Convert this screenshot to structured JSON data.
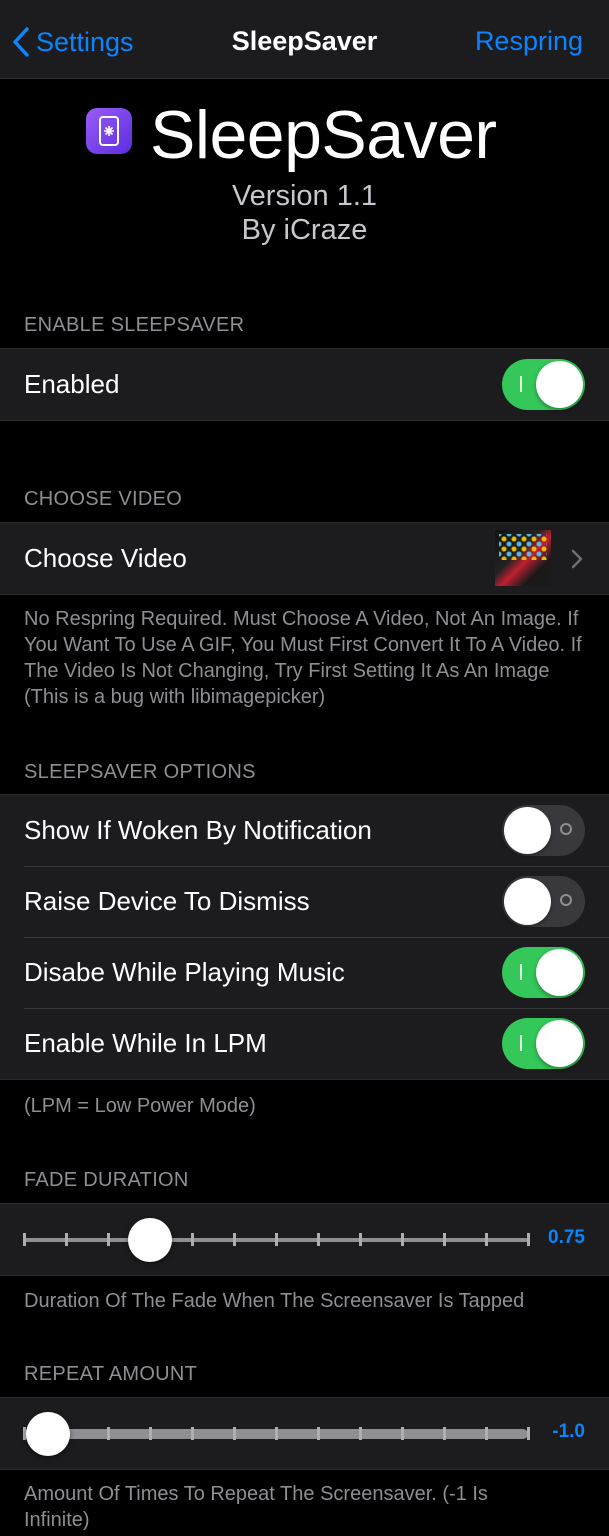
{
  "nav": {
    "back_label": "Settings",
    "title": "SleepSaver",
    "right_label": "Respring"
  },
  "header": {
    "app_name": "SleepSaver",
    "version": "Version 1.1",
    "author": "By iCraze"
  },
  "sections": {
    "enable": {
      "header": "ENABLE SLEEPSAVER",
      "enabled_label": "Enabled",
      "enabled_on": true
    },
    "video": {
      "header": "CHOOSE VIDEO",
      "choose_label": "Choose Video",
      "footer": "No Respring Required. Must Choose A Video, Not An Image. If You Want To Use A GIF, You Must First Convert It To A Video. If The Video Is Not Changing, Try First Setting It As An Image (This is a bug with libimagepicker)"
    },
    "options": {
      "header": "SLEEPSAVER OPTIONS",
      "items": [
        {
          "label": "Show If Woken By Notification",
          "on": false
        },
        {
          "label": "Raise Device To Dismiss",
          "on": false
        },
        {
          "label": "Disabe While Playing Music",
          "on": true
        },
        {
          "label": "Enable While In LPM",
          "on": true
        }
      ],
      "footer": "(LPM = Low Power Mode)"
    },
    "fade": {
      "header": "FADE DURATION",
      "value": "0.75",
      "position_fraction": 0.25,
      "footer": "Duration Of The Fade When The Screensaver Is Tapped"
    },
    "repeat": {
      "header": "REPEAT AMOUNT",
      "value": "-1.0",
      "position_fraction": 0.0,
      "footer": "Amount Of Times To Repeat The Screensaver. (-1 Is Infinite)"
    }
  },
  "colors": {
    "accent": "#0a84ff",
    "toggle_on": "#34c759",
    "cell_bg": "#1c1c1e",
    "bg": "#000000"
  }
}
